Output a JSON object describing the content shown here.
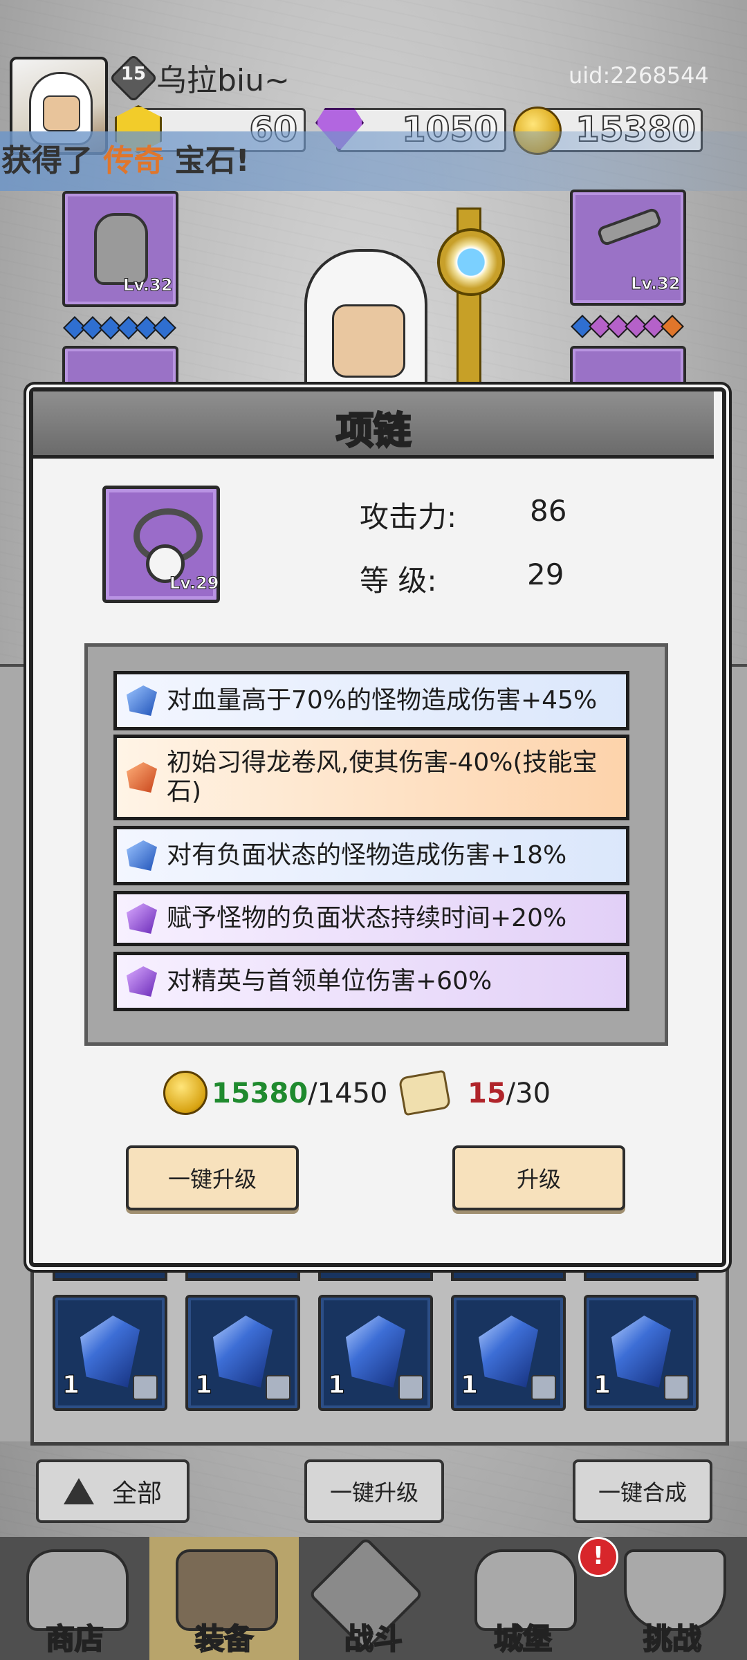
{
  "header": {
    "player_level": "15",
    "player_name": "乌拉biu~",
    "uid": "uid:2268544",
    "currencies": {
      "energy": "60",
      "gems": "1050",
      "gold": "15380"
    }
  },
  "banner": {
    "prefix": "获得了",
    "highlight": "传奇",
    "suffix": "宝石!"
  },
  "equip_slots": {
    "left_lv": "Lv.32",
    "right_lv": "Lv.32"
  },
  "modal": {
    "title": "项链",
    "item_level": "Lv.29",
    "attack_label": "攻击力:",
    "attack_value": "86",
    "level_label": "等 级:",
    "level_value": "29",
    "affixes": [
      {
        "text": "对血量高于70%的怪物造成伤害+45%",
        "color": "blue"
      },
      {
        "text": "初始习得龙卷风,使其伤害-40%(技能宝石)",
        "color": "orange"
      },
      {
        "text": "对有负面状态的怪物造成伤害+18%",
        "color": "blue"
      },
      {
        "text": "赋予怪物的负面状态持续时间+20%",
        "color": "purple"
      },
      {
        "text": "对精英与首领单位伤害+60%",
        "color": "purple"
      }
    ],
    "gold_have": "15380",
    "gold_need": "/1450",
    "scroll_have": "15",
    "scroll_need": "/30",
    "btn_upgrade_all": "一键升级",
    "btn_upgrade": "升级"
  },
  "inventory": {
    "slot_counts": [
      "1",
      "1",
      "1",
      "1",
      "1"
    ]
  },
  "actions": {
    "filter": "全部",
    "upgrade_all": "一键升级",
    "merge_all": "一键合成"
  },
  "tabs": [
    {
      "label": "商店"
    },
    {
      "label": "装备"
    },
    {
      "label": "战斗"
    },
    {
      "label": "城堡"
    },
    {
      "label": "挑战"
    }
  ],
  "alert_badge": "!",
  "colors": {
    "gold_have": "#1f8a2e",
    "scroll_have": "#b0242a",
    "banner_highlight": "#e0762b"
  }
}
